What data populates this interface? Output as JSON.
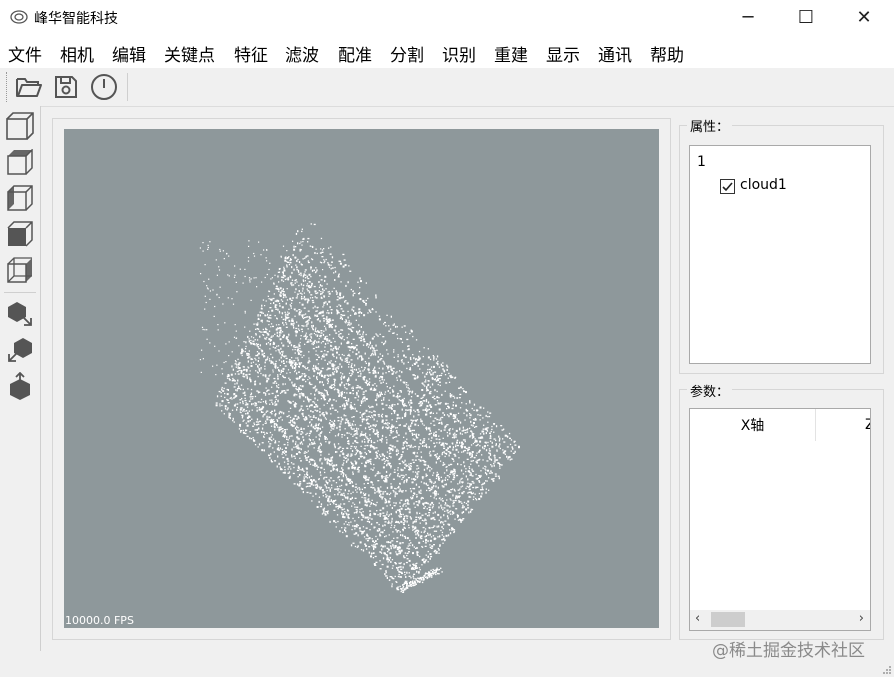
{
  "window": {
    "title": "峰华智能科技",
    "minimize_glyph": "─",
    "maximize_glyph": "☐",
    "close_glyph": "✕"
  },
  "menubar": {
    "items": [
      "文件",
      "相机",
      "编辑",
      "关键点",
      "特征",
      "滤波",
      "配准",
      "分割",
      "识别",
      "重建",
      "显示",
      "通讯",
      "帮助"
    ]
  },
  "toolbar": {
    "icons": [
      "open-folder-icon",
      "save-icon",
      "power-icon"
    ]
  },
  "left_toolbar": {
    "icons": [
      "cube-view-front-icon",
      "cube-view-top-icon",
      "cube-view-left-icon",
      "cube-view-right-icon",
      "cube-view-iso-icon",
      "cube-export-icon",
      "cube-import-icon",
      "cube-upload-icon"
    ]
  },
  "viewer": {
    "fps_text": "10000.0 FPS",
    "background": "#8e989b",
    "point_color": "#ffffff"
  },
  "properties_panel": {
    "title": "属性：",
    "root_label": "1",
    "child_label": "cloud1",
    "child_checked": true
  },
  "params_panel": {
    "title": "参数：",
    "columns": [
      "X轴",
      "Z"
    ]
  },
  "watermark": "@稀土掘金技术社区"
}
